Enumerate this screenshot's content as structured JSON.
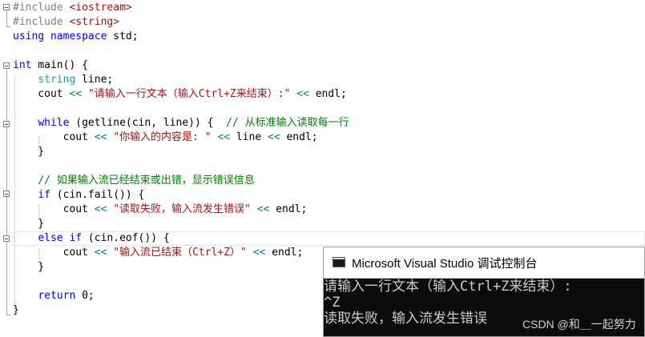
{
  "editor": {
    "lines": [
      [
        {
          "t": "#include ",
          "c": "pp"
        },
        {
          "t": "<iostream>",
          "c": "inc"
        }
      ],
      [
        {
          "t": "#include ",
          "c": "pp"
        },
        {
          "t": "<string>",
          "c": "inc"
        }
      ],
      [
        {
          "t": "using",
          "c": "kw"
        },
        {
          "t": " ",
          "c": ""
        },
        {
          "t": "namespace",
          "c": "kw"
        },
        {
          "t": " std;",
          "c": ""
        }
      ],
      [],
      [
        {
          "t": "int",
          "c": "kw"
        },
        {
          "t": " main() {",
          "c": ""
        }
      ],
      [
        {
          "t": "    ",
          "c": ""
        },
        {
          "t": "string",
          "c": "tp"
        },
        {
          "t": " line;",
          "c": ""
        }
      ],
      [
        {
          "t": "    cout ",
          "c": ""
        },
        {
          "t": "<<",
          "c": "op"
        },
        {
          "t": " ",
          "c": ""
        },
        {
          "t": "\"请输入一行文本（输入Ctrl+Z来结束）:\"",
          "c": "str"
        },
        {
          "t": " ",
          "c": ""
        },
        {
          "t": "<<",
          "c": "op"
        },
        {
          "t": " endl;",
          "c": ""
        }
      ],
      [],
      [
        {
          "t": "    ",
          "c": ""
        },
        {
          "t": "while",
          "c": "kw"
        },
        {
          "t": " (getline(cin, line)) {  ",
          "c": ""
        },
        {
          "t": "// 从标准输入读取每一行",
          "c": "cm"
        }
      ],
      [
        {
          "t": "        cout ",
          "c": ""
        },
        {
          "t": "<<",
          "c": "op"
        },
        {
          "t": " ",
          "c": ""
        },
        {
          "t": "\"你输入的内容是: \"",
          "c": "str"
        },
        {
          "t": " ",
          "c": ""
        },
        {
          "t": "<<",
          "c": "op"
        },
        {
          "t": " line ",
          "c": ""
        },
        {
          "t": "<<",
          "c": "op"
        },
        {
          "t": " endl;",
          "c": ""
        }
      ],
      [
        {
          "t": "    }",
          "c": ""
        }
      ],
      [],
      [
        {
          "t": "    ",
          "c": ""
        },
        {
          "t": "// 如果输入流已经结束或出错，显示错误信息",
          "c": "cm"
        }
      ],
      [
        {
          "t": "    ",
          "c": ""
        },
        {
          "t": "if",
          "c": "kw"
        },
        {
          "t": " (cin.fail()) {",
          "c": ""
        }
      ],
      [
        {
          "t": "        cout ",
          "c": ""
        },
        {
          "t": "<<",
          "c": "op"
        },
        {
          "t": " ",
          "c": ""
        },
        {
          "t": "\"读取失败，输入流发生错误\"",
          "c": "str"
        },
        {
          "t": " ",
          "c": ""
        },
        {
          "t": "<<",
          "c": "op"
        },
        {
          "t": " endl;",
          "c": ""
        }
      ],
      [
        {
          "t": "    }",
          "c": ""
        }
      ],
      [
        {
          "t": "    ",
          "c": ""
        },
        {
          "t": "else",
          "c": "kw"
        },
        {
          "t": " ",
          "c": ""
        },
        {
          "t": "if",
          "c": "kw"
        },
        {
          "t": " (cin.eof()) {",
          "c": ""
        }
      ],
      [
        {
          "t": "        cout ",
          "c": ""
        },
        {
          "t": "<<",
          "c": "op"
        },
        {
          "t": " ",
          "c": ""
        },
        {
          "t": "\"输入流已结束（Ctrl+Z）\"",
          "c": "str"
        },
        {
          "t": " ",
          "c": ""
        },
        {
          "t": "<<",
          "c": "op"
        },
        {
          "t": " endl;",
          "c": ""
        }
      ],
      [
        {
          "t": "    }",
          "c": ""
        }
      ],
      [],
      [
        {
          "t": "    ",
          "c": ""
        },
        {
          "t": "return",
          "c": "kw"
        },
        {
          "t": " 0;",
          "c": ""
        }
      ],
      [
        {
          "t": "}",
          "c": ""
        }
      ]
    ]
  },
  "console": {
    "title": "Microsoft Visual Studio 调试控制台",
    "output": [
      "请输入一行文本（输入Ctrl+Z来结束）:",
      "^Z",
      "读取失败，输入流发生错误"
    ]
  },
  "watermark": "CSDN @和＿一起努力",
  "colors": {
    "keyword": "#0000ff",
    "preprocessor": "#808080",
    "string": "#a31515",
    "comment": "#008000",
    "type": "#2b91af",
    "operator": "#008080",
    "console_bg": "#0c0c0c",
    "console_text": "#cccccc"
  }
}
